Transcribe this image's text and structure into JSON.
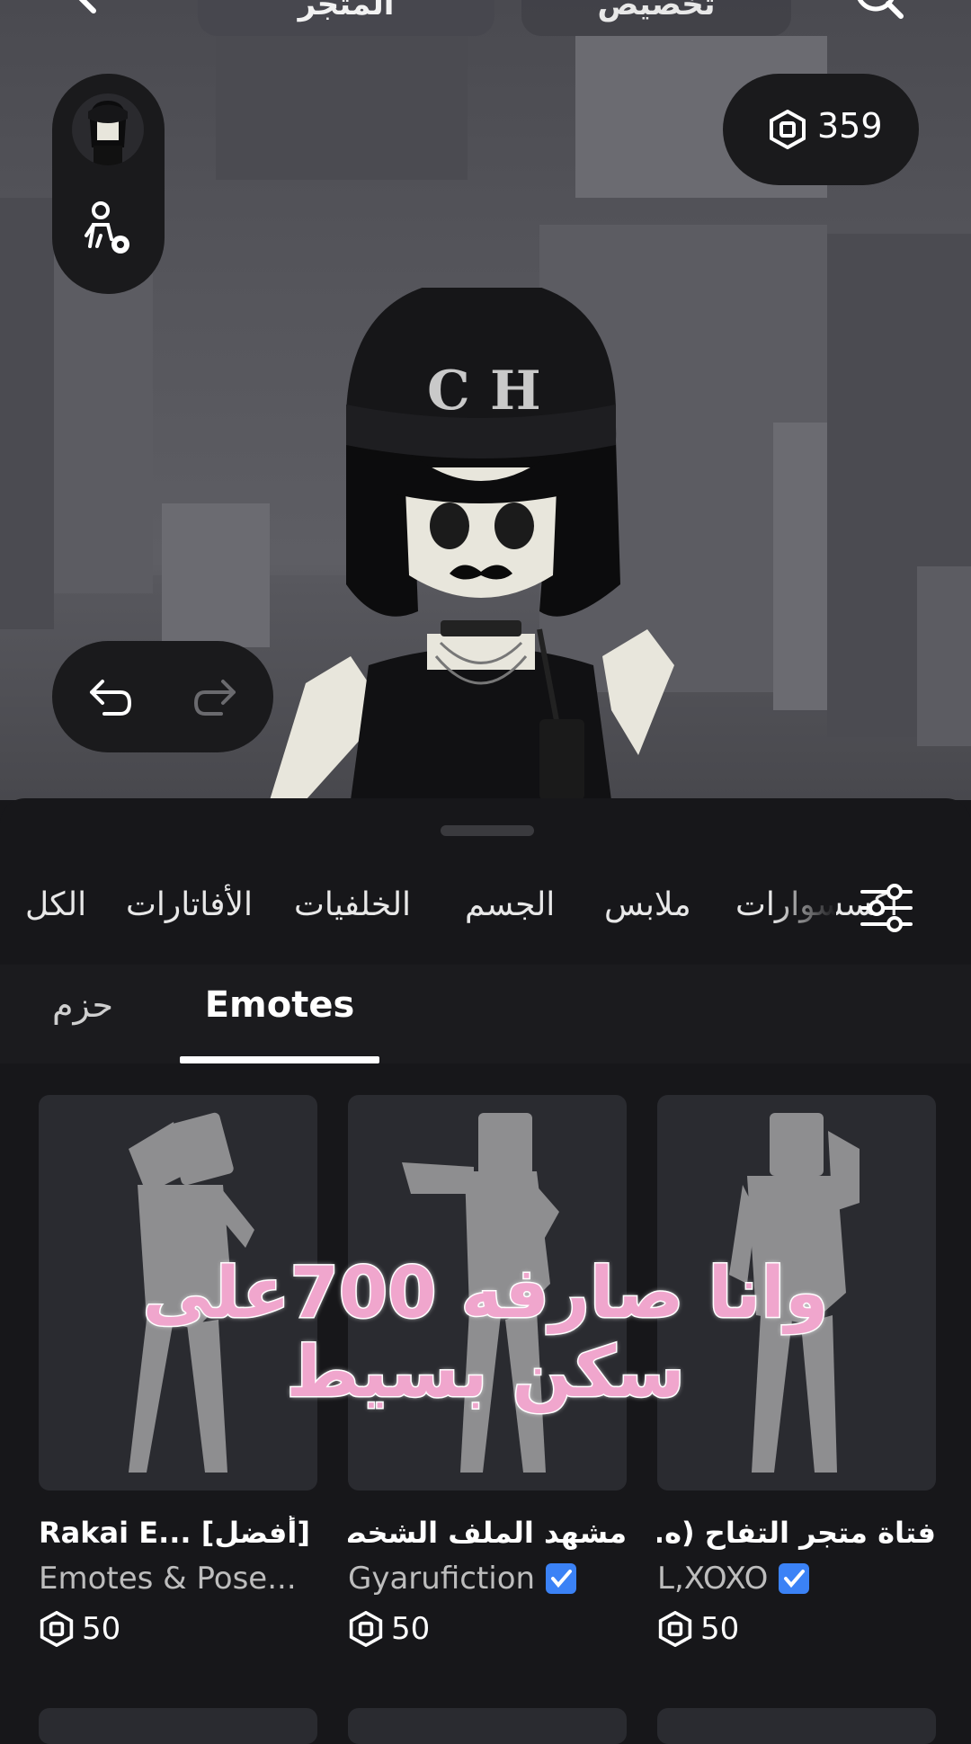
{
  "header": {
    "tab_active": "المتجر",
    "tab_other": "تخصيص",
    "back_icon": "back-arrow-icon",
    "search_icon": "search-icon"
  },
  "robux": {
    "balance": "359",
    "icon": "robux-icon"
  },
  "side_controls": {
    "avatar_icon": "avatar-thumbnail",
    "edit_icon": "avatar-settings-icon"
  },
  "history": {
    "undo_icon": "undo-icon",
    "redo_icon": "redo-icon"
  },
  "categories": [
    {
      "label": "اكسسوارات"
    },
    {
      "label": "ملابس"
    },
    {
      "label": "الجسم"
    },
    {
      "label": "الخلفيات"
    },
    {
      "label": "الأفاتارات"
    },
    {
      "label": "الكل"
    }
  ],
  "subtabs": {
    "active": "Emotes",
    "other": "حزم"
  },
  "items": [
    {
      "title": "Rakai E... [أفضل]",
      "creator": "Emotes & Pose...",
      "verified": false,
      "price": "50"
    },
    {
      "title": "مشهد الملف الشخص...",
      "creator": "Gyarufiction",
      "verified": true,
      "price": "50"
    },
    {
      "title": "فتاة متجر التفاح (ه...",
      "creator": "L,XOXO",
      "verified": true,
      "price": "50"
    }
  ],
  "overlay": {
    "caption": "وانا صارفه 700على سكن بسيط"
  },
  "colors": {
    "background": "#17171a",
    "accent_verified": "#3b82f6",
    "caption": "#f0a6cd"
  }
}
